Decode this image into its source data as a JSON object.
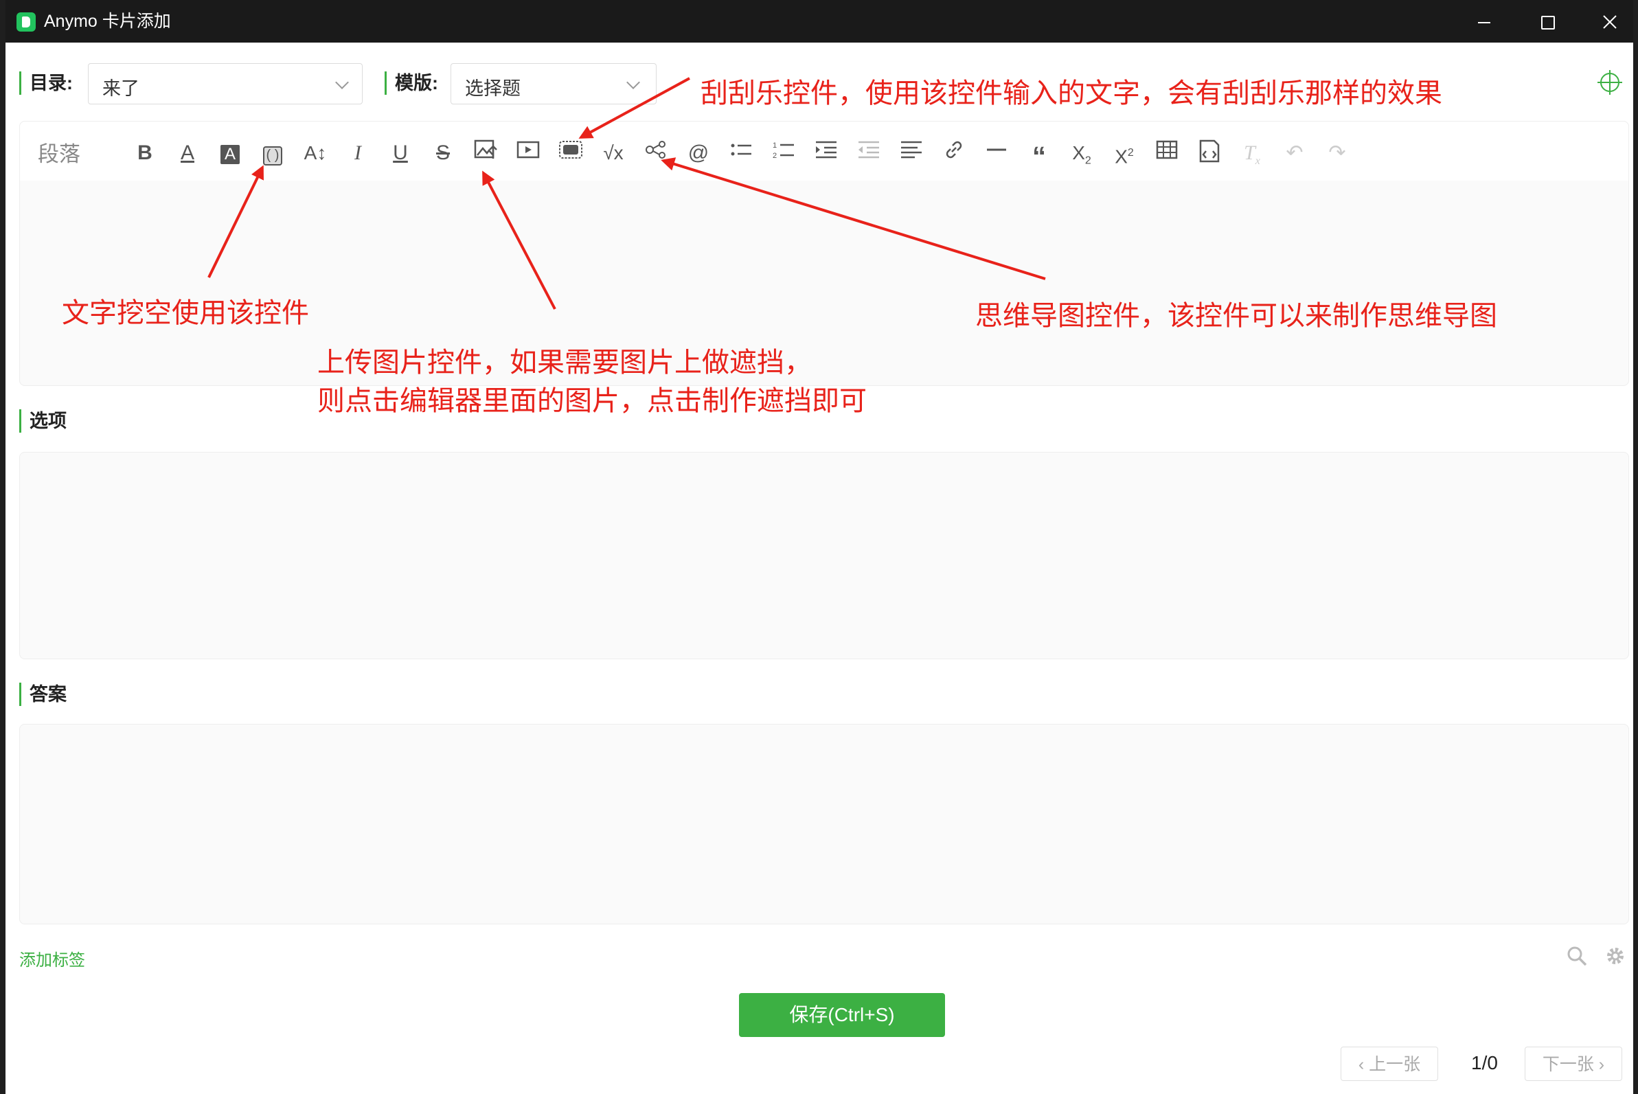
{
  "window": {
    "title": "Anymo 卡片添加",
    "controls": [
      "minimize",
      "maximize",
      "close"
    ]
  },
  "header": {
    "directory_label": "目录:",
    "directory_value": "来了",
    "template_label": "模版:",
    "template_value": "选择题"
  },
  "editor": {
    "paragraph_label": "段落",
    "toolbar_icons": [
      "bold-icon",
      "font-color-icon",
      "background-color-icon",
      "cloze-icon",
      "font-size-icon",
      "italic-icon",
      "underline-icon",
      "strikethrough-icon",
      "image-upload-icon",
      "video-icon",
      "scratch-card-icon",
      "formula-icon",
      "mindmap-icon",
      "mention-icon",
      "bullet-list-icon",
      "numbered-list-icon",
      "indent-icon",
      "outdent-icon",
      "align-icon",
      "link-icon",
      "horizontal-rule-icon",
      "quote-icon",
      "subscript-icon",
      "superscript-icon",
      "table-icon",
      "code-block-icon",
      "clear-format-icon",
      "undo-icon",
      "redo-icon"
    ]
  },
  "sections": {
    "options_label": "选项",
    "answer_label": "答案"
  },
  "footer": {
    "add_tag": "添加标签",
    "save_button": "保存(Ctrl+S)",
    "prev_button": "上一张",
    "next_button": "下一张",
    "page_indicator": "1/0"
  },
  "annotations": {
    "scratch_card": "刮刮乐控件，使用该控件输入的文字，会有刮刮乐那样的效果",
    "cloze": "文字挖空使用该控件",
    "image_upload_line1": "上传图片控件，如果需要图片上做遮挡，",
    "image_upload_line2": "则点击编辑器里面的图片，点击制作遮挡即可",
    "mindmap": "思维导图控件，该控件可以来制作思维导图"
  },
  "colors": {
    "accent": "#3cb043",
    "annotation": "#e8221a",
    "titlebar": "#1a1a1a"
  }
}
